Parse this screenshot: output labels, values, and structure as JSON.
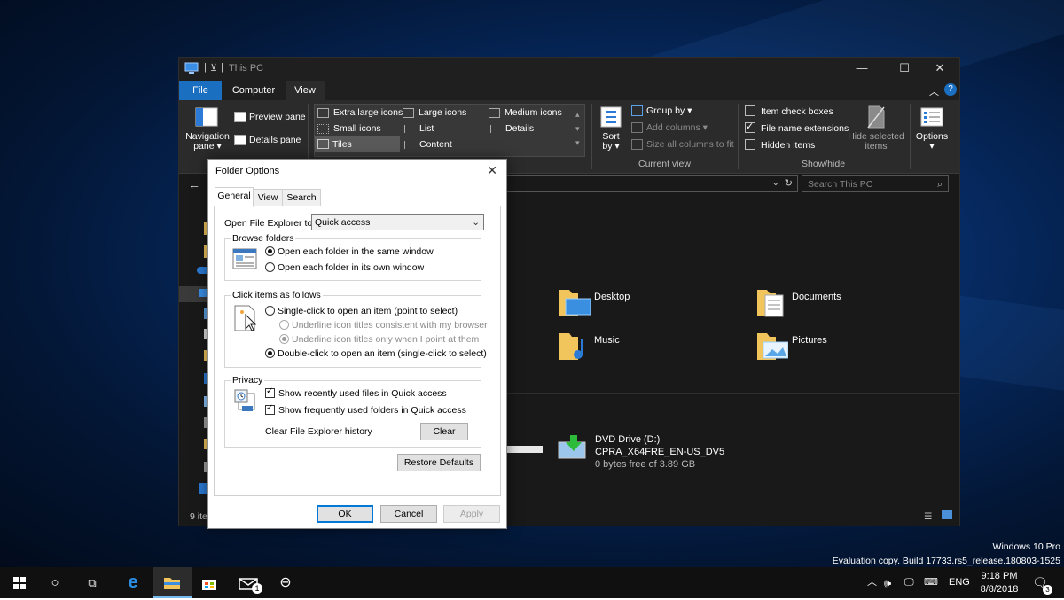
{
  "explorer": {
    "title": "This PC",
    "menu": {
      "file": "File",
      "computer": "Computer",
      "view": "View"
    },
    "panes": {
      "navigation": "Navigation\npane",
      "navigation_l1": "Navigation",
      "navigation_l2": "pane ▾",
      "preview": "Preview pane",
      "details": "Details pane"
    },
    "layout": {
      "extra_large": "Extra large icons",
      "large": "Large icons",
      "medium": "Medium icons",
      "small": "Small icons",
      "list": "List",
      "details": "Details",
      "tiles": "Tiles",
      "content": "Content"
    },
    "current_view": {
      "sort_l1": "Sort",
      "sort_l2": "by ▾",
      "group_by": "Group by ▾",
      "add_columns": "Add columns ▾",
      "size_columns": "Size all columns to fit",
      "label": "Current view"
    },
    "show_hide": {
      "item_check_boxes": "Item check boxes",
      "file_name_extensions": "File name extensions",
      "hidden_items": "Hidden items",
      "hide_selected_l1": "Hide selected",
      "hide_selected_l2": "items",
      "options": "Options",
      "label": "Show/hide",
      "item_check_boxes_checked": false,
      "file_name_extensions_checked": true,
      "hidden_items_checked": false
    },
    "search_placeholder": "Search This PC",
    "folders": [
      {
        "name": "Desktop"
      },
      {
        "name": "Documents"
      },
      {
        "name": "Music"
      },
      {
        "name": "Pictures"
      }
    ],
    "drive": {
      "name": "DVD Drive (D:)",
      "label": "CPRA_X64FRE_EN-US_DV5",
      "free": "0 bytes free of 3.89 GB"
    },
    "status": "9 ite"
  },
  "dialog": {
    "title": "Folder Options",
    "tabs": [
      "General",
      "View",
      "Search"
    ],
    "open_to_label": "Open File Explorer to:",
    "open_to_value": "Quick access",
    "browse": {
      "legend": "Browse folders",
      "same_window": "Open each folder in the same window",
      "own_window": "Open each folder in its own window"
    },
    "click": {
      "legend": "Click items as follows",
      "single": "Single-click to open an item (point to select)",
      "underline_browser": "Underline icon titles consistent with my browser",
      "underline_point": "Underline icon titles only when I point at them",
      "double": "Double-click to open an item (single-click to select)"
    },
    "privacy": {
      "legend": "Privacy",
      "recent_files": "Show recently used files in Quick access",
      "frequent_folders": "Show frequently used folders in Quick access",
      "clear_label": "Clear File Explorer history",
      "clear_button": "Clear"
    },
    "restore": "Restore Defaults",
    "ok": "OK",
    "cancel": "Cancel",
    "apply": "Apply"
  },
  "taskbar": {
    "lang": "ENG",
    "time": "9:18 PM",
    "date": "8/8/2018",
    "mail_badge": "1",
    "notif_badge": "3"
  },
  "watermark": {
    "line1": "Windows 10 Pro",
    "line2": "Evaluation copy. Build 17733.rs5_release.180803-1525"
  },
  "colors": {
    "accent": "#0078d7",
    "folder": "#f2c55c",
    "dark": "#191919"
  }
}
